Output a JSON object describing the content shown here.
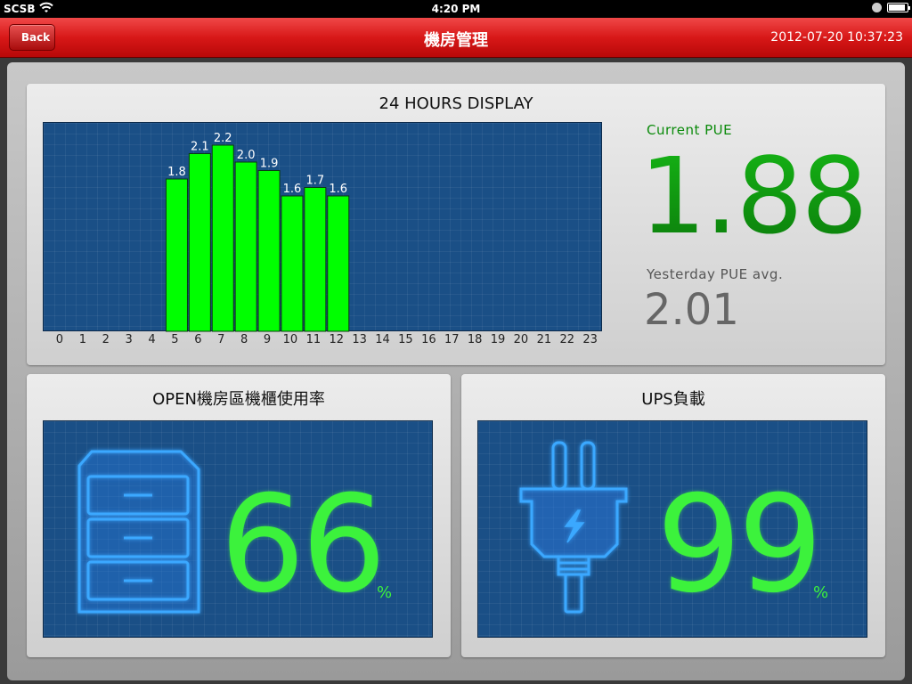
{
  "status_bar": {
    "carrier": "SCSB",
    "time": "4:20 PM"
  },
  "nav": {
    "back_label": "Back",
    "title": "機房管理",
    "datetime": "2012-07-20 10:37:23",
    "color": "#d81818"
  },
  "pue_panel": {
    "title": "24 HOURS DISPLAY",
    "current_label": "Current  PUE",
    "current_value": "1.88",
    "yesterday_label": "Yesterday  PUE  avg.",
    "yesterday_value": "2.01"
  },
  "chart_data": {
    "type": "bar",
    "title": "24 HOURS DISPLAY",
    "categories": [
      "0",
      "1",
      "2",
      "3",
      "4",
      "5",
      "6",
      "7",
      "8",
      "9",
      "10",
      "11",
      "12",
      "13",
      "14",
      "15",
      "16",
      "17",
      "18",
      "19",
      "20",
      "21",
      "22",
      "23"
    ],
    "values": [
      null,
      null,
      null,
      null,
      null,
      1.8,
      2.1,
      2.2,
      2.0,
      1.9,
      1.6,
      1.7,
      1.6,
      null,
      null,
      null,
      null,
      null,
      null,
      null,
      null,
      null,
      null,
      null
    ],
    "ylim": [
      0,
      2.4
    ],
    "bar_color": "#00ff00",
    "background_color": "#1a4f86",
    "grid": true
  },
  "rack_panel": {
    "title": "OPEN機房區機櫃使用率",
    "value": "66",
    "unit": "%",
    "icon": "cabinet-icon"
  },
  "ups_panel": {
    "title": "UPS負載",
    "value": "99",
    "unit": "%",
    "icon": "power-plug-icon"
  }
}
